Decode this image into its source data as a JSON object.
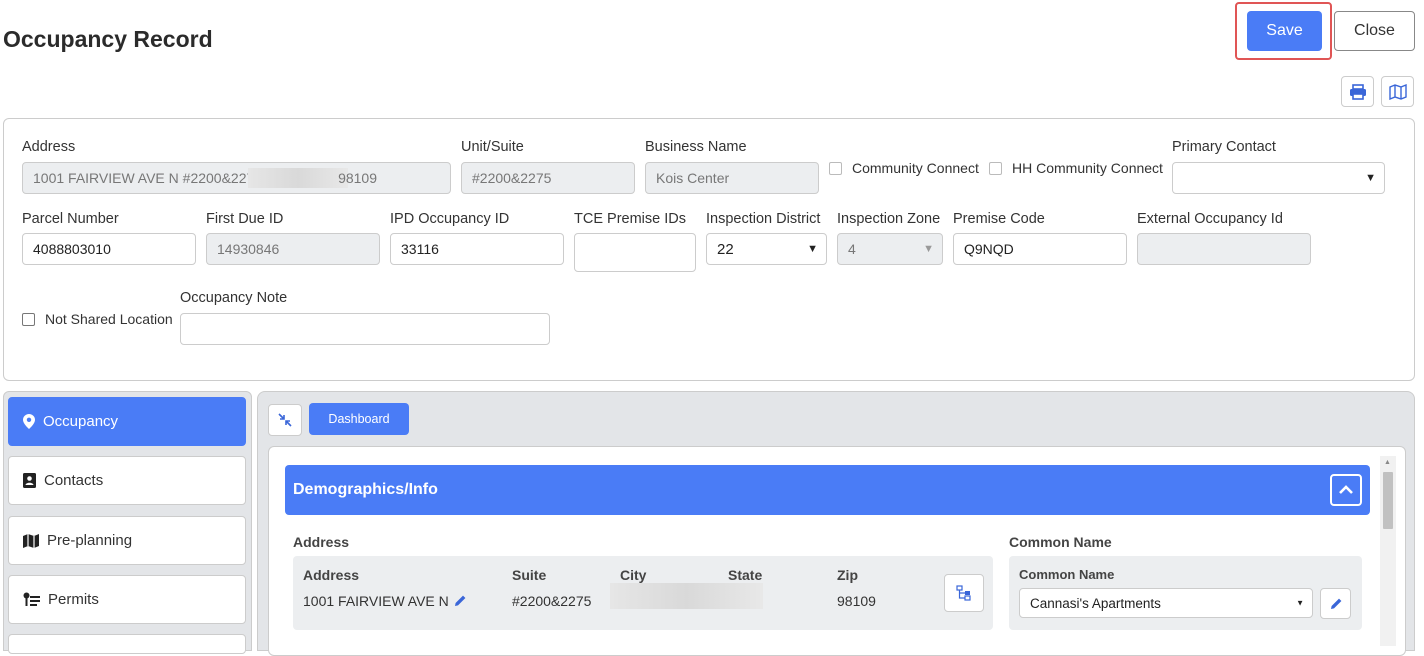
{
  "page": {
    "title": "Occupancy Record"
  },
  "toolbar": {
    "save_label": "Save",
    "close_label": "Close",
    "print_icon": "print-icon",
    "map_icon": "map-icon"
  },
  "form": {
    "address": {
      "label": "Address",
      "value": "1001 FAIRVIEW AVE N #2200&2275",
      "value_tail": "98109"
    },
    "unit_suite": {
      "label": "Unit/Suite",
      "value": "#2200&2275"
    },
    "business_name": {
      "label": "Business Name",
      "value": "Kois Center"
    },
    "community_connect": {
      "label": "Community Connect"
    },
    "hh_community_connect": {
      "label": "HH Community Connect"
    },
    "primary_contact": {
      "label": "Primary Contact",
      "value": ""
    },
    "parcel_number": {
      "label": "Parcel Number",
      "value": "4088803010"
    },
    "first_due_id": {
      "label": "First Due ID",
      "value": "14930846"
    },
    "ipd_occupancy_id": {
      "label": "IPD Occupancy ID",
      "value": "33116"
    },
    "tce_premise_ids": {
      "label": "TCE Premise IDs",
      "value": ""
    },
    "inspection_district": {
      "label": "Inspection District",
      "value": "22"
    },
    "inspection_zone": {
      "label": "Inspection Zone",
      "value": "4"
    },
    "premise_code": {
      "label": "Premise Code",
      "value": "Q9NQD"
    },
    "external_occupancy_id": {
      "label": "External Occupancy Id",
      "value": ""
    },
    "not_shared_location": {
      "label": "Not Shared Location"
    },
    "occupancy_note": {
      "label": "Occupancy Note",
      "value": ""
    }
  },
  "sidebar": {
    "items": [
      {
        "label": "Occupancy",
        "icon": "map-pin-icon",
        "active": true
      },
      {
        "label": "Contacts",
        "icon": "contact-card-icon"
      },
      {
        "label": "Pre-planning",
        "icon": "map-icon"
      },
      {
        "label": "Permits",
        "icon": "permit-list-icon"
      }
    ]
  },
  "content": {
    "dashboard_tab": "Dashboard",
    "section_title": "Demographics/Info",
    "address_section": {
      "heading": "Address",
      "columns": [
        "Address",
        "Suite",
        "City",
        "State",
        "Zip"
      ],
      "values": {
        "address": "1001 FAIRVIEW AVE N",
        "suite": "#2200&2275",
        "zip": "98109"
      }
    },
    "common_name_section": {
      "heading": "Common Name",
      "label": "Common Name",
      "value": "Cannasi's Apartments"
    }
  },
  "colors": {
    "accent": "#4a7cf6",
    "highlight": "#e05555"
  }
}
